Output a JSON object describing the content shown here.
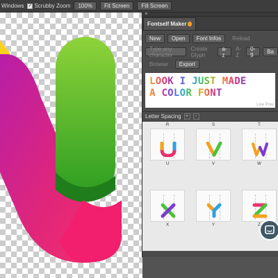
{
  "options_bar": {
    "windows_label": "Windows",
    "scrubby_zoom_label": "Scrubby Zoom",
    "zoom_100_label": "100%",
    "fit_screen_label": "Fit Screen",
    "fill_screen_label": "Fill Screen"
  },
  "panel": {
    "close_glyph": "×",
    "tab_title": "Fontself Maker",
    "toolbar": {
      "new": "New",
      "open": "Open",
      "font_infos": "Font Infos",
      "reload": "Reload"
    },
    "glyph_bar": {
      "input_placeholder": "Type any character",
      "create_glyph": "Create Glyph",
      "az": "a-z",
      "AZ": "A-Z",
      "digits": "0-9",
      "ba": "Ba"
    },
    "actions": {
      "browse": "Browse",
      "export": "Export"
    },
    "preview": {
      "line1": "LOOK I JUST MADE",
      "line2": "A COLOR FONT",
      "live_label": "Live Prev"
    },
    "letter_spacing": {
      "label": "Letter Spacing",
      "plus": "+",
      "minus": "-"
    },
    "grid": {
      "header_row": [
        "R",
        "S",
        "T"
      ],
      "rows": [
        {
          "glyphs": [
            "U",
            "V",
            "W"
          ],
          "labels": [
            "U",
            "V",
            "W"
          ]
        },
        {
          "glyphs": [
            "X",
            "Y",
            "Z"
          ],
          "labels": [
            "X",
            "Y",
            "Z"
          ]
        }
      ]
    }
  },
  "colors": {
    "panel_bg": "#4b4b4b",
    "chat_bubble": "#3f5866",
    "green": "#4cb42a",
    "magenta": "#e0267a"
  }
}
